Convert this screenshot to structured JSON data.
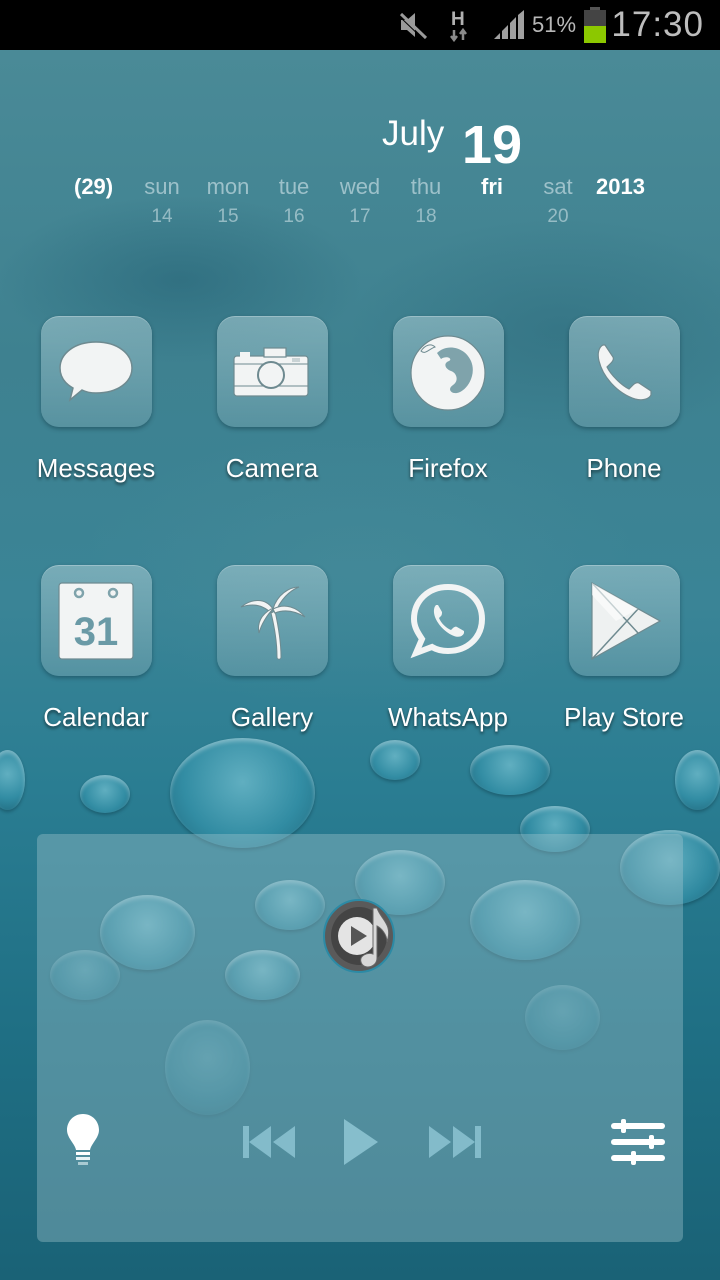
{
  "status_bar": {
    "icons": [
      "mute-icon",
      "hspa-data-icon",
      "signal-icon",
      "battery-icon"
    ],
    "network_type": "H",
    "battery_percent": "51%",
    "battery_level": 0.51,
    "battery_color": "#8cc800",
    "clock": "17:30"
  },
  "calendar_widget": {
    "month": "July",
    "day": "19",
    "week_number": "(29)",
    "year": "2013",
    "weekdays": [
      {
        "name": "sun",
        "date": "14"
      },
      {
        "name": "mon",
        "date": "15"
      },
      {
        "name": "tue",
        "date": "16"
      },
      {
        "name": "wed",
        "date": "17"
      },
      {
        "name": "thu",
        "date": "18"
      },
      {
        "name": "fri",
        "date": "",
        "today": true
      },
      {
        "name": "sat",
        "date": "20"
      }
    ]
  },
  "apps": [
    {
      "label": "Messages",
      "icon": "speech-bubble-icon"
    },
    {
      "label": "Camera",
      "icon": "camera-icon"
    },
    {
      "label": "Firefox",
      "icon": "firefox-icon"
    },
    {
      "label": "Phone",
      "icon": "phone-handset-icon"
    },
    {
      "label": "Calendar",
      "icon": "calendar-31-icon",
      "icon_text": "31"
    },
    {
      "label": "Gallery",
      "icon": "palm-tree-icon"
    },
    {
      "label": "WhatsApp",
      "icon": "whatsapp-icon"
    },
    {
      "label": "Play Store",
      "icon": "play-store-icon"
    }
  ],
  "music_widget": {
    "logo_icon": "music-player-icon",
    "controls": [
      "lightbulb-icon",
      "previous-icon",
      "play-icon",
      "next-icon",
      "equalizer-icon"
    ]
  }
}
